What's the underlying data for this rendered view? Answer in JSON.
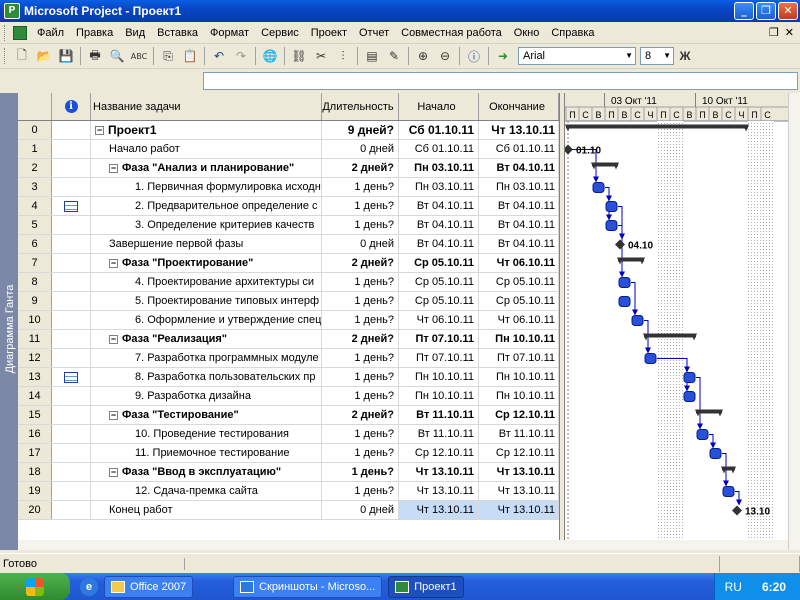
{
  "window": {
    "title": "Microsoft Project - Проект1",
    "minimize_glyph": "_",
    "restore_glyph": "❐",
    "close_glyph": "✕"
  },
  "menu": [
    "Файл",
    "Правка",
    "Вид",
    "Вставка",
    "Формат",
    "Сервис",
    "Проект",
    "Отчет",
    "Совместная работа",
    "Окно",
    "Справка"
  ],
  "menu_restore_glyph": "❐",
  "menu_close_glyph": "✕",
  "toolbar": {
    "font_name": "Arial",
    "font_size": "8",
    "bold_label": "Ж",
    "buttons": [
      "new-icon",
      "open-icon",
      "save-icon",
      "print-icon",
      "print-preview-icon",
      "spelling-icon",
      "copy-icon",
      "paste-icon",
      "undo-icon",
      "redo-icon",
      "hyperlink-icon",
      "link-tasks-icon",
      "unlink-tasks-icon",
      "split-task-icon",
      "task-info-icon",
      "zoom-in-icon",
      "zoom-out-icon",
      "help-icon",
      "go-to-task-icon"
    ]
  },
  "view_bar": {
    "label": "Диаграмма Ганта"
  },
  "table": {
    "headers": {
      "indicator": "i",
      "name": "Название задачи",
      "duration": "Длительность",
      "start": "Начало",
      "finish": "Окончание"
    },
    "rows": [
      {
        "id": "0",
        "ind": "",
        "toggle": "−",
        "name": "Проект1",
        "indent": 0,
        "dur": "9 дней?",
        "start": "Сб 01.10.11",
        "finish": "Чт 13.10.11",
        "bold": true,
        "big": true
      },
      {
        "id": "1",
        "ind": "",
        "toggle": "",
        "name": "Начало работ",
        "indent": 1,
        "dur": "0 дней",
        "start": "Сб 01.10.11",
        "finish": "Сб 01.10.11",
        "bold": false
      },
      {
        "id": "2",
        "ind": "",
        "toggle": "−",
        "name": "Фаза \"Анализ и планирование\"",
        "indent": 1,
        "dur": "2 дней?",
        "start": "Пн 03.10.11",
        "finish": "Вт 04.10.11",
        "bold": true
      },
      {
        "id": "3",
        "ind": "",
        "toggle": "",
        "name": "1. Первичная формулировка исходн",
        "indent": 2,
        "dur": "1 день?",
        "start": "Пн 03.10.11",
        "finish": "Пн 03.10.11",
        "bold": false
      },
      {
        "id": "4",
        "ind": "note",
        "toggle": "",
        "name": "2. Предварительное определение с",
        "indent": 2,
        "dur": "1 день?",
        "start": "Вт 04.10.11",
        "finish": "Вт 04.10.11",
        "bold": false
      },
      {
        "id": "5",
        "ind": "",
        "toggle": "",
        "name": "3. Определение критериев качеств",
        "indent": 2,
        "dur": "1 день?",
        "start": "Вт 04.10.11",
        "finish": "Вт 04.10.11",
        "bold": false
      },
      {
        "id": "6",
        "ind": "",
        "toggle": "",
        "name": "Завершение первой фазы",
        "indent": 1,
        "dur": "0 дней",
        "start": "Вт 04.10.11",
        "finish": "Вт 04.10.11",
        "bold": false
      },
      {
        "id": "7",
        "ind": "",
        "toggle": "−",
        "name": "Фаза \"Проектирование\"",
        "indent": 1,
        "dur": "2 дней?",
        "start": "Ср 05.10.11",
        "finish": "Чт 06.10.11",
        "bold": true
      },
      {
        "id": "8",
        "ind": "",
        "toggle": "",
        "name": "4. Проектирование архитектуры си",
        "indent": 2,
        "dur": "1 день?",
        "start": "Ср 05.10.11",
        "finish": "Ср 05.10.11",
        "bold": false
      },
      {
        "id": "9",
        "ind": "",
        "toggle": "",
        "name": "5. Проектирование типовых интерф",
        "indent": 2,
        "dur": "1 день?",
        "start": "Ср 05.10.11",
        "finish": "Ср 05.10.11",
        "bold": false
      },
      {
        "id": "10",
        "ind": "",
        "toggle": "",
        "name": "6. Оформление и утверждение спец",
        "indent": 2,
        "dur": "1 день?",
        "start": "Чт 06.10.11",
        "finish": "Чт 06.10.11",
        "bold": false
      },
      {
        "id": "11",
        "ind": "",
        "toggle": "−",
        "name": "Фаза \"Реализация\"",
        "indent": 1,
        "dur": "2 дней?",
        "start": "Пт 07.10.11",
        "finish": "Пн 10.10.11",
        "bold": true
      },
      {
        "id": "12",
        "ind": "",
        "toggle": "",
        "name": "7. Разработка программных модуле",
        "indent": 2,
        "dur": "1 день?",
        "start": "Пт 07.10.11",
        "finish": "Пт 07.10.11",
        "bold": false
      },
      {
        "id": "13",
        "ind": "note",
        "toggle": "",
        "name": "8. Разработка пользовательских пр",
        "indent": 2,
        "dur": "1 день?",
        "start": "Пн 10.10.11",
        "finish": "Пн 10.10.11",
        "bold": false
      },
      {
        "id": "14",
        "ind": "",
        "toggle": "",
        "name": "9. Разработка дизайна",
        "indent": 2,
        "dur": "1 день?",
        "start": "Пн 10.10.11",
        "finish": "Пн 10.10.11",
        "bold": false
      },
      {
        "id": "15",
        "ind": "",
        "toggle": "−",
        "name": "Фаза \"Тестирование\"",
        "indent": 1,
        "dur": "2 дней?",
        "start": "Вт 11.10.11",
        "finish": "Ср 12.10.11",
        "bold": true
      },
      {
        "id": "16",
        "ind": "",
        "toggle": "",
        "name": "10. Проведение тестирования",
        "indent": 2,
        "dur": "1 день?",
        "start": "Вт 11.10.11",
        "finish": "Вт 11.10.11",
        "bold": false
      },
      {
        "id": "17",
        "ind": "",
        "toggle": "",
        "name": "11. Приемочное тестирование",
        "indent": 2,
        "dur": "1 день?",
        "start": "Ср 12.10.11",
        "finish": "Ср 12.10.11",
        "bold": false
      },
      {
        "id": "18",
        "ind": "",
        "toggle": "−",
        "name": "Фаза \"Ввод в эксплуатацию\"",
        "indent": 1,
        "dur": "1 день?",
        "start": "Чт 13.10.11",
        "finish": "Чт 13.10.11",
        "bold": true
      },
      {
        "id": "19",
        "ind": "",
        "toggle": "",
        "name": "12. Сдача-премка сайта",
        "indent": 2,
        "dur": "1 день?",
        "start": "Чт 13.10.11",
        "finish": "Чт 13.10.11",
        "bold": false
      },
      {
        "id": "20",
        "ind": "",
        "toggle": "",
        "name": "Конец работ",
        "indent": 1,
        "dur": "0 дней",
        "start": "Чт 13.10.11",
        "finish": "Чт 13.10.11",
        "bold": false,
        "selected": true
      }
    ]
  },
  "gantt": {
    "week_labels": [
      "03 Окт '11",
      "10 Окт '11"
    ],
    "day_letters": [
      "П",
      "С",
      "В",
      "П",
      "В",
      "С",
      "Ч",
      "П",
      "С",
      "В",
      "П",
      "В",
      "С",
      "Ч",
      "П",
      "С"
    ],
    "milestone_labels": {
      "1": "01.10",
      "6": "04.10",
      "20": "13.10"
    },
    "tasks": [
      {
        "row": 0,
        "type": "summary",
        "start": 0,
        "end": 14
      },
      {
        "row": 1,
        "type": "milestone",
        "day": 0
      },
      {
        "row": 2,
        "type": "summary",
        "start": 2,
        "end": 4
      },
      {
        "row": 3,
        "type": "task",
        "start": 2,
        "end": 3
      },
      {
        "row": 4,
        "type": "task",
        "start": 3,
        "end": 4
      },
      {
        "row": 5,
        "type": "task",
        "start": 3,
        "end": 4
      },
      {
        "row": 6,
        "type": "milestone",
        "day": 4
      },
      {
        "row": 7,
        "type": "summary",
        "start": 4,
        "end": 6
      },
      {
        "row": 8,
        "type": "task",
        "start": 4,
        "end": 5
      },
      {
        "row": 9,
        "type": "task",
        "start": 4,
        "end": 5
      },
      {
        "row": 10,
        "type": "task",
        "start": 5,
        "end": 6
      },
      {
        "row": 11,
        "type": "summary",
        "start": 6,
        "end": 10
      },
      {
        "row": 12,
        "type": "task",
        "start": 6,
        "end": 7
      },
      {
        "row": 13,
        "type": "task",
        "start": 9,
        "end": 10
      },
      {
        "row": 14,
        "type": "task",
        "start": 9,
        "end": 10
      },
      {
        "row": 15,
        "type": "summary",
        "start": 10,
        "end": 12
      },
      {
        "row": 16,
        "type": "task",
        "start": 10,
        "end": 11
      },
      {
        "row": 17,
        "type": "task",
        "start": 11,
        "end": 12
      },
      {
        "row": 18,
        "type": "summary",
        "start": 12,
        "end": 13
      },
      {
        "row": 19,
        "type": "task",
        "start": 12,
        "end": 13
      },
      {
        "row": 20,
        "type": "milestone",
        "day": 13
      }
    ],
    "links": [
      [
        1,
        3
      ],
      [
        3,
        4
      ],
      [
        3,
        5
      ],
      [
        4,
        6
      ],
      [
        5,
        8
      ],
      [
        8,
        10
      ],
      [
        10,
        12
      ],
      [
        12,
        13
      ],
      [
        12,
        14
      ],
      [
        13,
        16
      ],
      [
        16,
        17
      ],
      [
        17,
        19
      ],
      [
        19,
        20
      ]
    ],
    "nonworking_day_pairs": [
      [
        7,
        8
      ],
      [
        14,
        15
      ]
    ]
  },
  "status": {
    "ready": "Готово"
  },
  "taskbar": {
    "start_label": "",
    "buttons": [
      {
        "label": "Office 2007",
        "active": false
      },
      {
        "label": "Скриншоты - Microso...",
        "active": false
      },
      {
        "label": "Проект1",
        "active": true
      }
    ],
    "lang": "RU",
    "clock": "6:20"
  }
}
